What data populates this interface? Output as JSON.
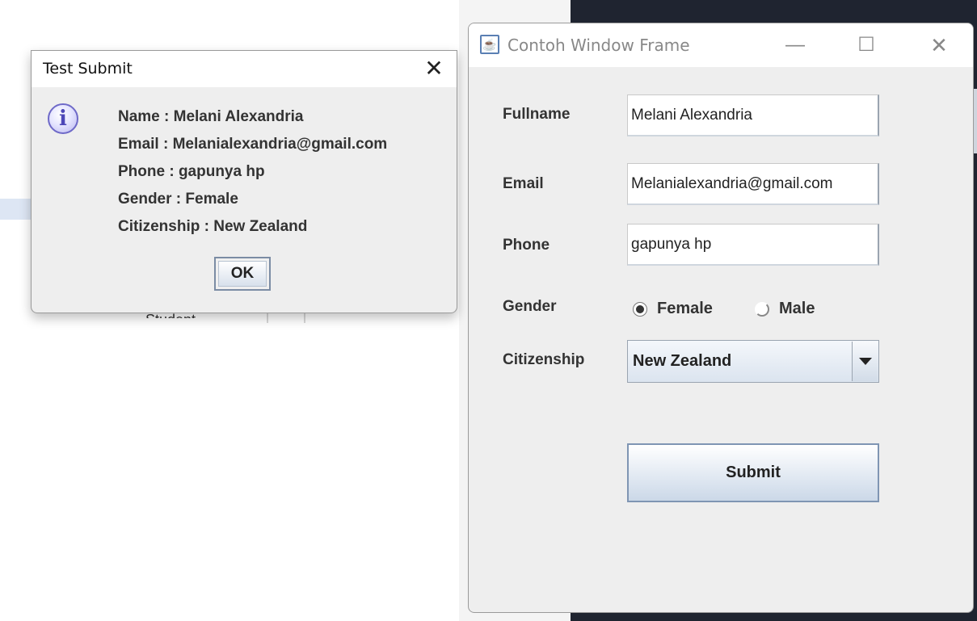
{
  "background": {
    "cut_text": "Student..."
  },
  "dialog": {
    "title": "Test Submit",
    "close_glyph": "✕",
    "icon": "info-icon",
    "lines": [
      "Name : Melani Alexandria",
      "Email : Melanialexandria@gmail.com",
      "Phone : gapunya hp",
      "Gender : Female",
      "Citizenship : New Zealand"
    ],
    "ok_label": "OK"
  },
  "window": {
    "title": "Contoh Window Frame",
    "icon": "java-icon",
    "controls": {
      "minimize": "—",
      "maximize": "☐",
      "close": "✕"
    },
    "form": {
      "fullname_label": "Fullname",
      "fullname_value": "Melani Alexandria",
      "email_label": "Email",
      "email_value": "Melanialexandria@gmail.com",
      "phone_label": "Phone",
      "phone_value": "gapunya hp",
      "gender_label": "Gender",
      "gender_options": [
        "Female",
        "Male"
      ],
      "gender_selected": "Female",
      "citizenship_label": "Citizenship",
      "citizenship_value": "New Zealand",
      "submit_label": "Submit"
    }
  }
}
